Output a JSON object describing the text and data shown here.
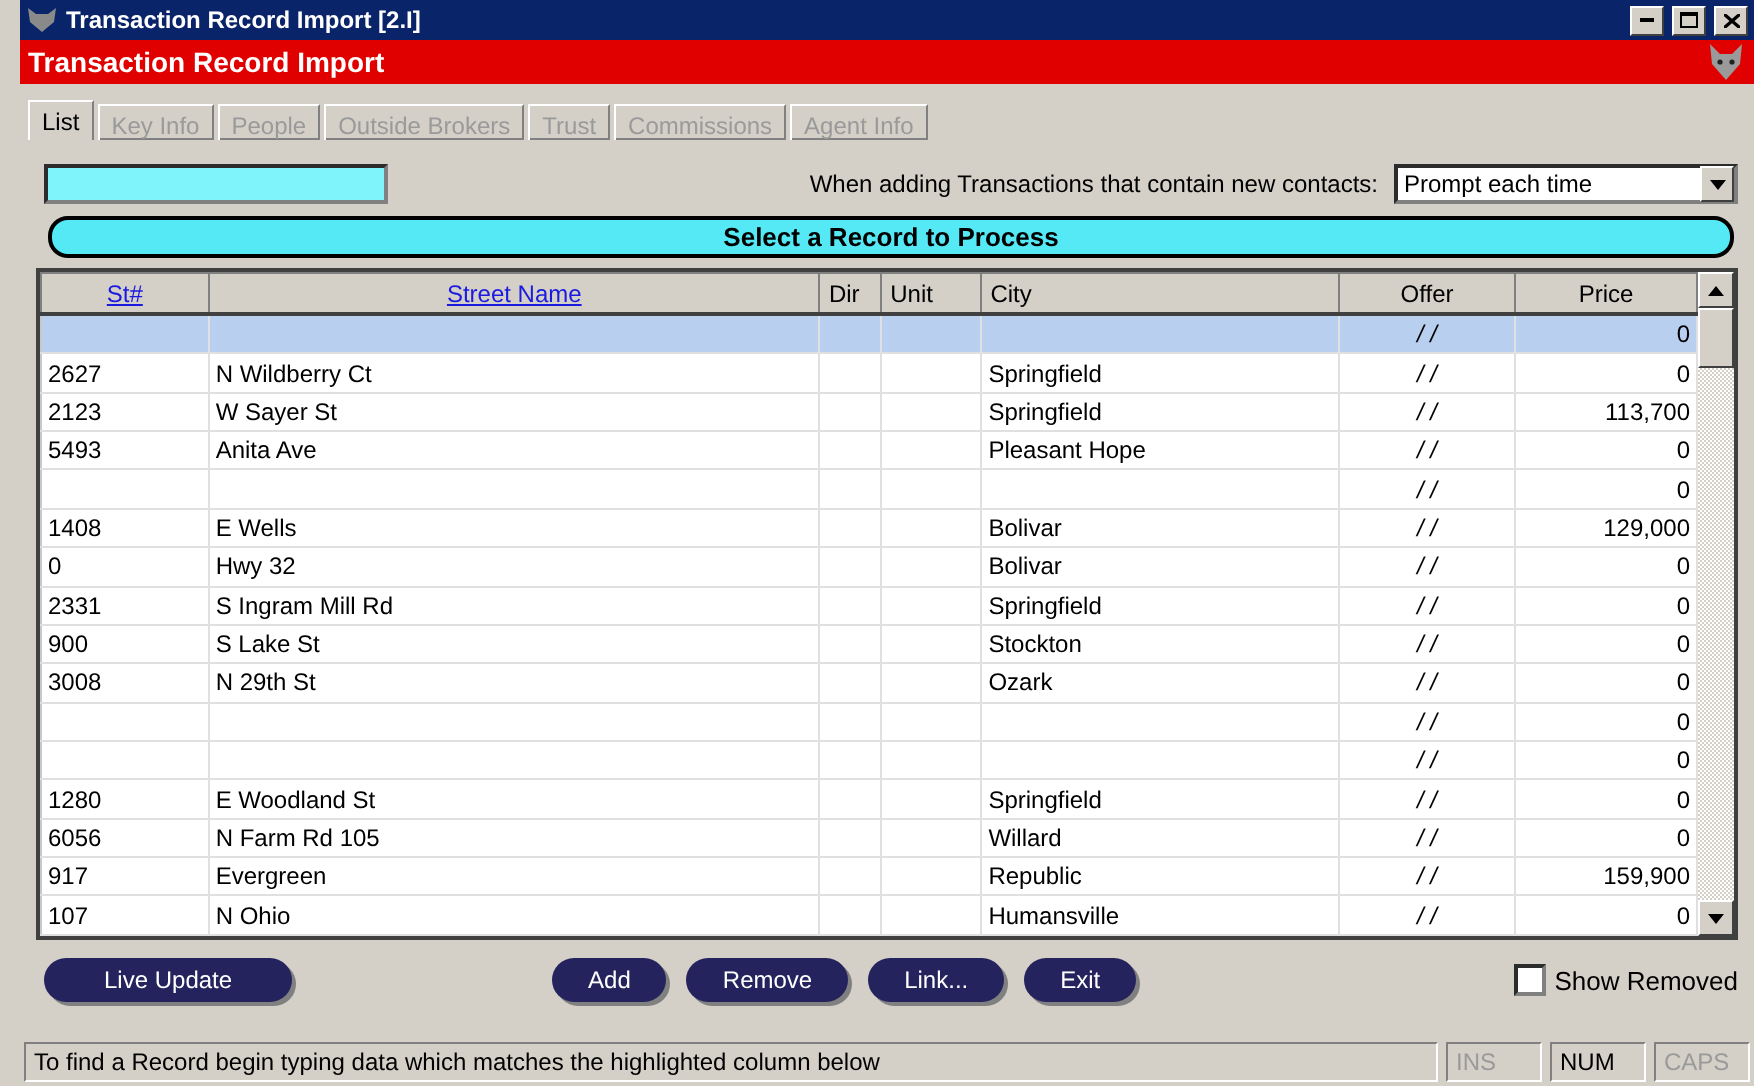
{
  "window": {
    "title": "Transaction Record Import [2.I]"
  },
  "header": {
    "title": "Transaction Record Import"
  },
  "tabs": [
    {
      "label": "List",
      "selected": true,
      "disabled": false
    },
    {
      "label": "Key Info",
      "selected": false,
      "disabled": true
    },
    {
      "label": "People",
      "selected": false,
      "disabled": true
    },
    {
      "label": "Outside Brokers",
      "selected": false,
      "disabled": true
    },
    {
      "label": "Trust",
      "selected": false,
      "disabled": true
    },
    {
      "label": "Commissions",
      "selected": false,
      "disabled": true
    },
    {
      "label": "Agent Info",
      "selected": false,
      "disabled": true
    }
  ],
  "new_contacts": {
    "label": "When adding Transactions that contain new contacts:",
    "value": "Prompt each time"
  },
  "banner": "Select a Record to Process",
  "table": {
    "columns": [
      {
        "label": "St#",
        "kind": "link"
      },
      {
        "label": "Street Name",
        "kind": "link"
      },
      {
        "label": "Dir",
        "kind": "plain"
      },
      {
        "label": "Unit",
        "kind": "plain"
      },
      {
        "label": "City",
        "kind": "plain"
      },
      {
        "label": "Offer",
        "kind": "plain"
      },
      {
        "label": "Price",
        "kind": "plain"
      }
    ],
    "rows": [
      {
        "selected": true,
        "cells": [
          "",
          "",
          "",
          "",
          "",
          "/ /",
          "0"
        ]
      },
      {
        "selected": false,
        "cells": [
          "2627",
          "N Wildberry Ct",
          "",
          "",
          "Springfield",
          "/ /",
          "0"
        ]
      },
      {
        "selected": false,
        "cells": [
          "2123",
          "W Sayer St",
          "",
          "",
          "Springfield",
          "/ /",
          "113,700"
        ]
      },
      {
        "selected": false,
        "cells": [
          "5493",
          "Anita Ave",
          "",
          "",
          "Pleasant Hope",
          "/ /",
          "0"
        ]
      },
      {
        "selected": false,
        "cells": [
          "",
          "",
          "",
          "",
          "",
          "/ /",
          "0"
        ]
      },
      {
        "selected": false,
        "cells": [
          "1408",
          "E Wells",
          "",
          "",
          "Bolivar",
          "/ /",
          "129,000"
        ]
      },
      {
        "selected": false,
        "cells": [
          "0",
          "Hwy 32",
          "",
          "",
          "Bolivar",
          "/ /",
          "0"
        ]
      },
      {
        "selected": false,
        "cells": [
          "2331",
          "S Ingram Mill Rd",
          "",
          "",
          "Springfield",
          "/ /",
          "0"
        ]
      },
      {
        "selected": false,
        "cells": [
          "900",
          "S Lake St",
          "",
          "",
          "Stockton",
          "/ /",
          "0"
        ]
      },
      {
        "selected": false,
        "cells": [
          "3008",
          "N 29th St",
          "",
          "",
          "Ozark",
          "/ /",
          "0"
        ]
      },
      {
        "selected": false,
        "cells": [
          "",
          "",
          "",
          "",
          "",
          "/ /",
          "0"
        ]
      },
      {
        "selected": false,
        "cells": [
          "",
          "",
          "",
          "",
          "",
          "/ /",
          "0"
        ]
      },
      {
        "selected": false,
        "cells": [
          "1280",
          "E Woodland St",
          "",
          "",
          "Springfield",
          "/ /",
          "0"
        ]
      },
      {
        "selected": false,
        "cells": [
          "6056",
          "N Farm Rd 105",
          "",
          "",
          "Willard",
          "/ /",
          "0"
        ]
      },
      {
        "selected": false,
        "cells": [
          "917",
          "Evergreen",
          "",
          "",
          "Republic",
          "/ /",
          "159,900"
        ]
      },
      {
        "selected": false,
        "cells": [
          "107",
          "N Ohio",
          "",
          "",
          "Humansville",
          "/ /",
          "0"
        ]
      }
    ]
  },
  "buttons_left": [
    "Live Update"
  ],
  "buttons_center": [
    "Add",
    "Remove",
    "Link...",
    "Exit"
  ],
  "show_removed": {
    "label": "Show Removed",
    "checked": false
  },
  "status_bar": {
    "message": "To find a Record begin typing data which matches the highlighted column below",
    "indicators": [
      {
        "label": "INS",
        "on": false
      },
      {
        "label": "NUM",
        "on": true
      },
      {
        "label": "CAPS",
        "on": false
      }
    ]
  }
}
